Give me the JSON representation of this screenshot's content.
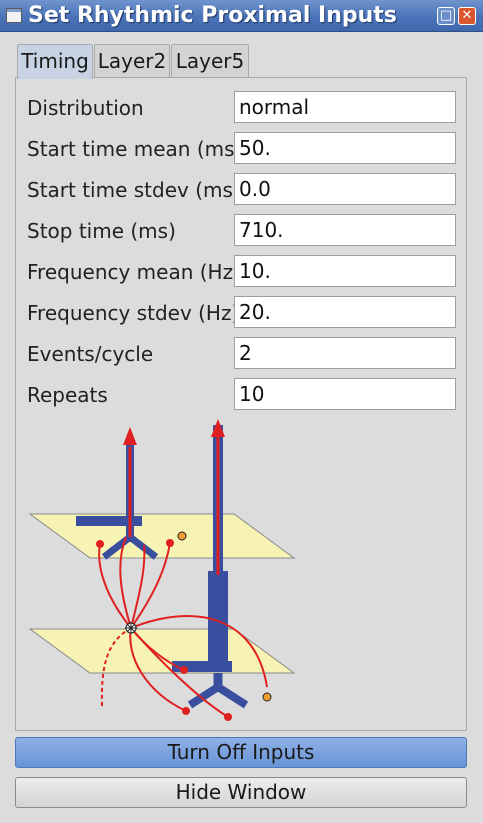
{
  "window": {
    "title": "Set Rhythmic Proximal Inputs",
    "controls": [
      "maximize-icon",
      "close-icon"
    ]
  },
  "tabs": [
    {
      "label": "Timing",
      "active": true
    },
    {
      "label": "Layer2",
      "active": false
    },
    {
      "label": "Layer5",
      "active": false
    }
  ],
  "fields": [
    {
      "label": "Distribution",
      "value": "normal"
    },
    {
      "label": "Start time mean (ms)",
      "value": "50."
    },
    {
      "label": "Start time stdev (ms)",
      "value": "0.0"
    },
    {
      "label": "Stop time (ms)",
      "value": "710."
    },
    {
      "label": "Frequency mean (Hz)",
      "value": "10."
    },
    {
      "label": "Frequency stdev (Hz)",
      "value": "20."
    },
    {
      "label": "Events/cycle",
      "value": "2"
    },
    {
      "label": "Repeats",
      "value": "10"
    }
  ],
  "buttons": {
    "turn_off": "Turn Off Inputs",
    "hide": "Hide Window"
  },
  "colors": {
    "accent": "#6794d6",
    "neuron": "#3a4ea0",
    "input": "#e02020",
    "layer_plane": "#f7f3b5",
    "synapse_marker": "#f0a030"
  }
}
